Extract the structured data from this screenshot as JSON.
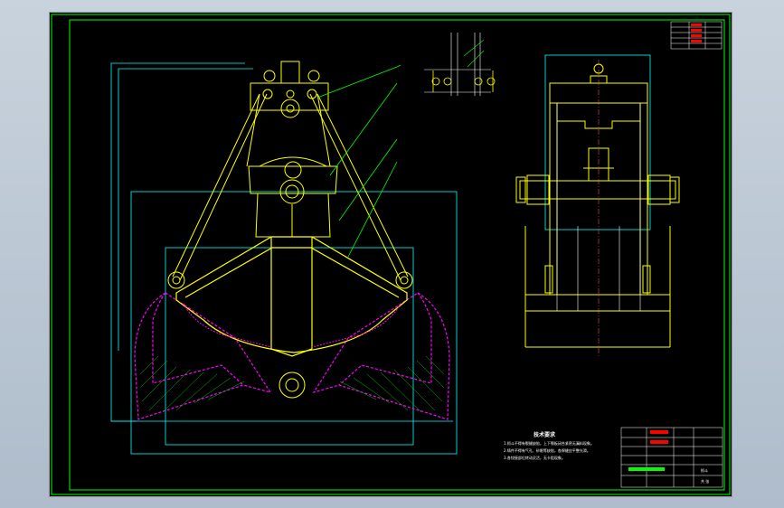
{
  "window": {
    "background": "#c3cdd8",
    "viewport_background": "#000000"
  },
  "colors": {
    "frame": "#00ff00",
    "outline": "#ffff00",
    "construction": "#00ffff",
    "open_position": "#ff00ff",
    "hatch": "#00ff00",
    "centerline": "#ff6b6b",
    "text": "#ffffff"
  },
  "technical_requirements": {
    "title": "技术要求",
    "lines": [
      "1.抓斗不得有裂缝缺陷，上下颚板闭合紧密无漏料现象。",
      "2.铸件不得有气孔、砂眼等缺陷，各焊缝应平整光滑。",
      "3.各铰接部位转动灵活，无卡阻现象。"
    ]
  },
  "title_block": {
    "drawing_name": "抓斗",
    "sheet_label": "共 张"
  },
  "icons": [
    "grab-bucket-drawing",
    "centerline-mark"
  ]
}
